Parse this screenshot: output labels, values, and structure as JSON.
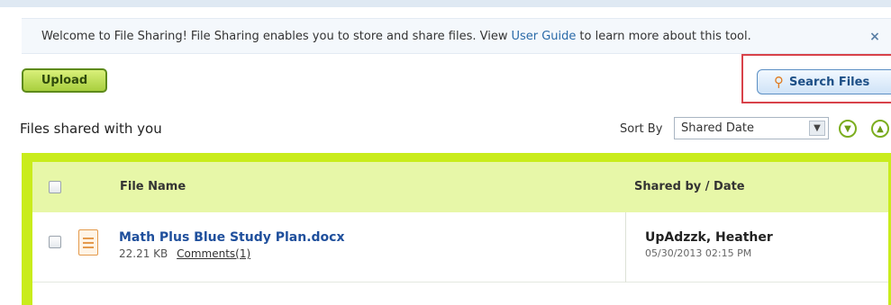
{
  "welcome": {
    "text_before": "Welcome to File Sharing! File Sharing enables you to store and share files. View",
    "link": "User Guide",
    "text_after": "to learn more about this tool.",
    "close_glyph": "×"
  },
  "toolbar": {
    "upload_label": "Upload",
    "search_label": "Search Files",
    "search_icon": "search-icon",
    "search_icon_glyph": "⚲"
  },
  "section": {
    "title": "Files shared with you"
  },
  "sort": {
    "label": "Sort By",
    "selected": "Shared Date",
    "dropdown_glyph": "▼",
    "descending_glyph": "▼",
    "ascending_glyph": "▲"
  },
  "table": {
    "columns": [
      "File Name",
      "Shared by / Date"
    ],
    "rows": [
      {
        "file_name": "Math Plus Blue Study Plan.docx",
        "size": "22.21 KB",
        "comments": "Comments(1)",
        "shared_by": "UpAdzzk, Heather",
        "date": "05/30/2013 02:15 PM"
      }
    ]
  },
  "colors": {
    "accent_green": "#c9ec1c",
    "header_green": "#e7f7a8",
    "link_blue": "#1f4f9c",
    "highlight_red": "#d8424a"
  }
}
